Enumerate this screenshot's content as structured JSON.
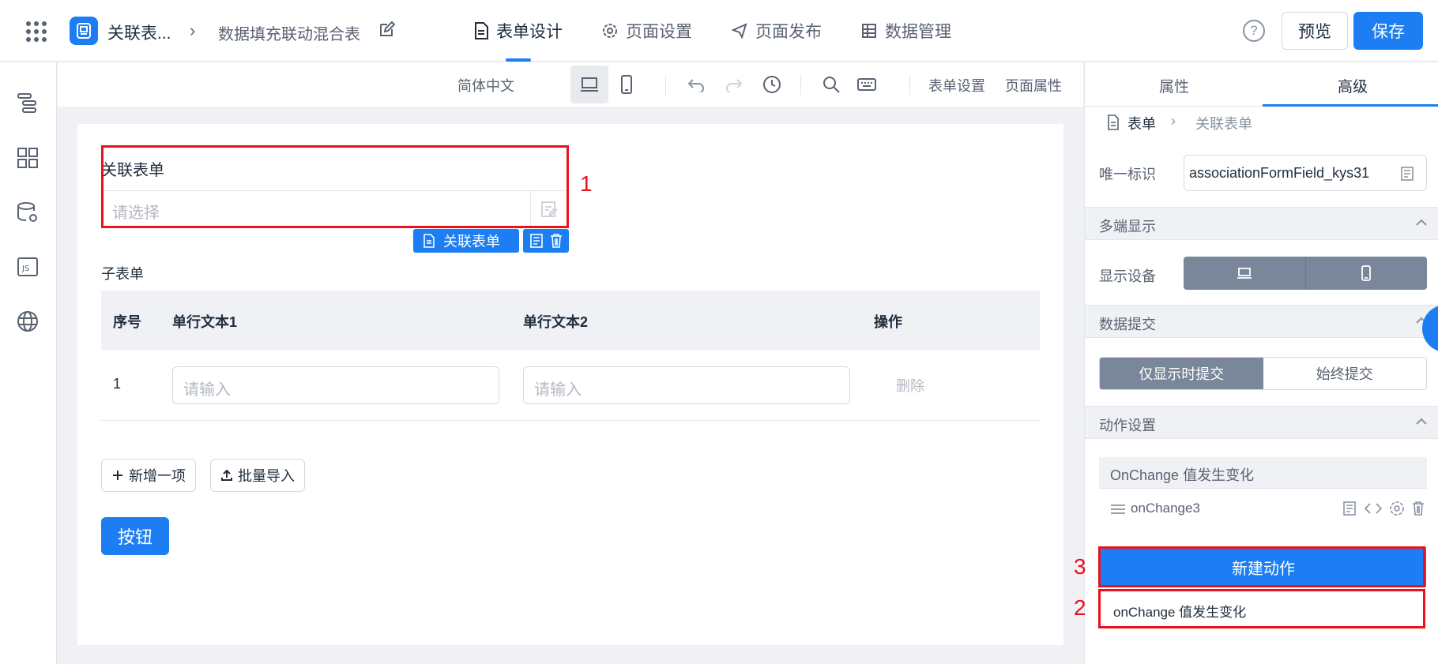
{
  "topbar": {
    "app_name": "关联表...",
    "page_name": "数据填充联动混合表",
    "tabs": [
      {
        "label": "表单设计",
        "active": true
      },
      {
        "label": "页面设置",
        "active": false
      },
      {
        "label": "页面发布",
        "active": false
      },
      {
        "label": "数据管理",
        "active": false
      }
    ],
    "help_glyph": "?",
    "preview_label": "预览",
    "save_label": "保存"
  },
  "toolbar": {
    "language": "简体中文",
    "form_settings": "表单设置",
    "page_properties": "页面属性"
  },
  "canvas": {
    "field_label": "关联表单",
    "select_placeholder": "请选择",
    "component_tag": "关联表单",
    "subform_label": "子表单",
    "table_headers": [
      "序号",
      "单行文本1",
      "单行文本2",
      "操作"
    ],
    "rows": [
      {
        "index": "1",
        "placeholder1": "请输入",
        "placeholder2": "请输入",
        "action": "删除"
      }
    ],
    "add_item": "新增一项",
    "batch_import": "批量导入",
    "button_label": "按钮"
  },
  "annotations": [
    "1",
    "2",
    "3"
  ],
  "right_panel": {
    "tabs": [
      "属性",
      "高级"
    ],
    "active_tab": "高级",
    "breadcrumb": [
      "表单",
      "关联表单"
    ],
    "unique_id_label": "唯一标识",
    "unique_id_value": "associationFormField_kys31",
    "multi_display_label": "多端显示",
    "display_device_label": "显示设备",
    "data_submit_label": "数据提交",
    "submit_options": [
      "仅显示时提交",
      "始终提交"
    ],
    "action_settings_label": "动作设置",
    "action_group": "OnChange 值发生变化",
    "action_name": "onChange3",
    "new_action": "新建动作",
    "dropdown_option": "onChange 值发生变化"
  },
  "colors": {
    "accent": "#1c7ef2",
    "highlight": "#e8121e",
    "segment_active": "#7a8699"
  }
}
